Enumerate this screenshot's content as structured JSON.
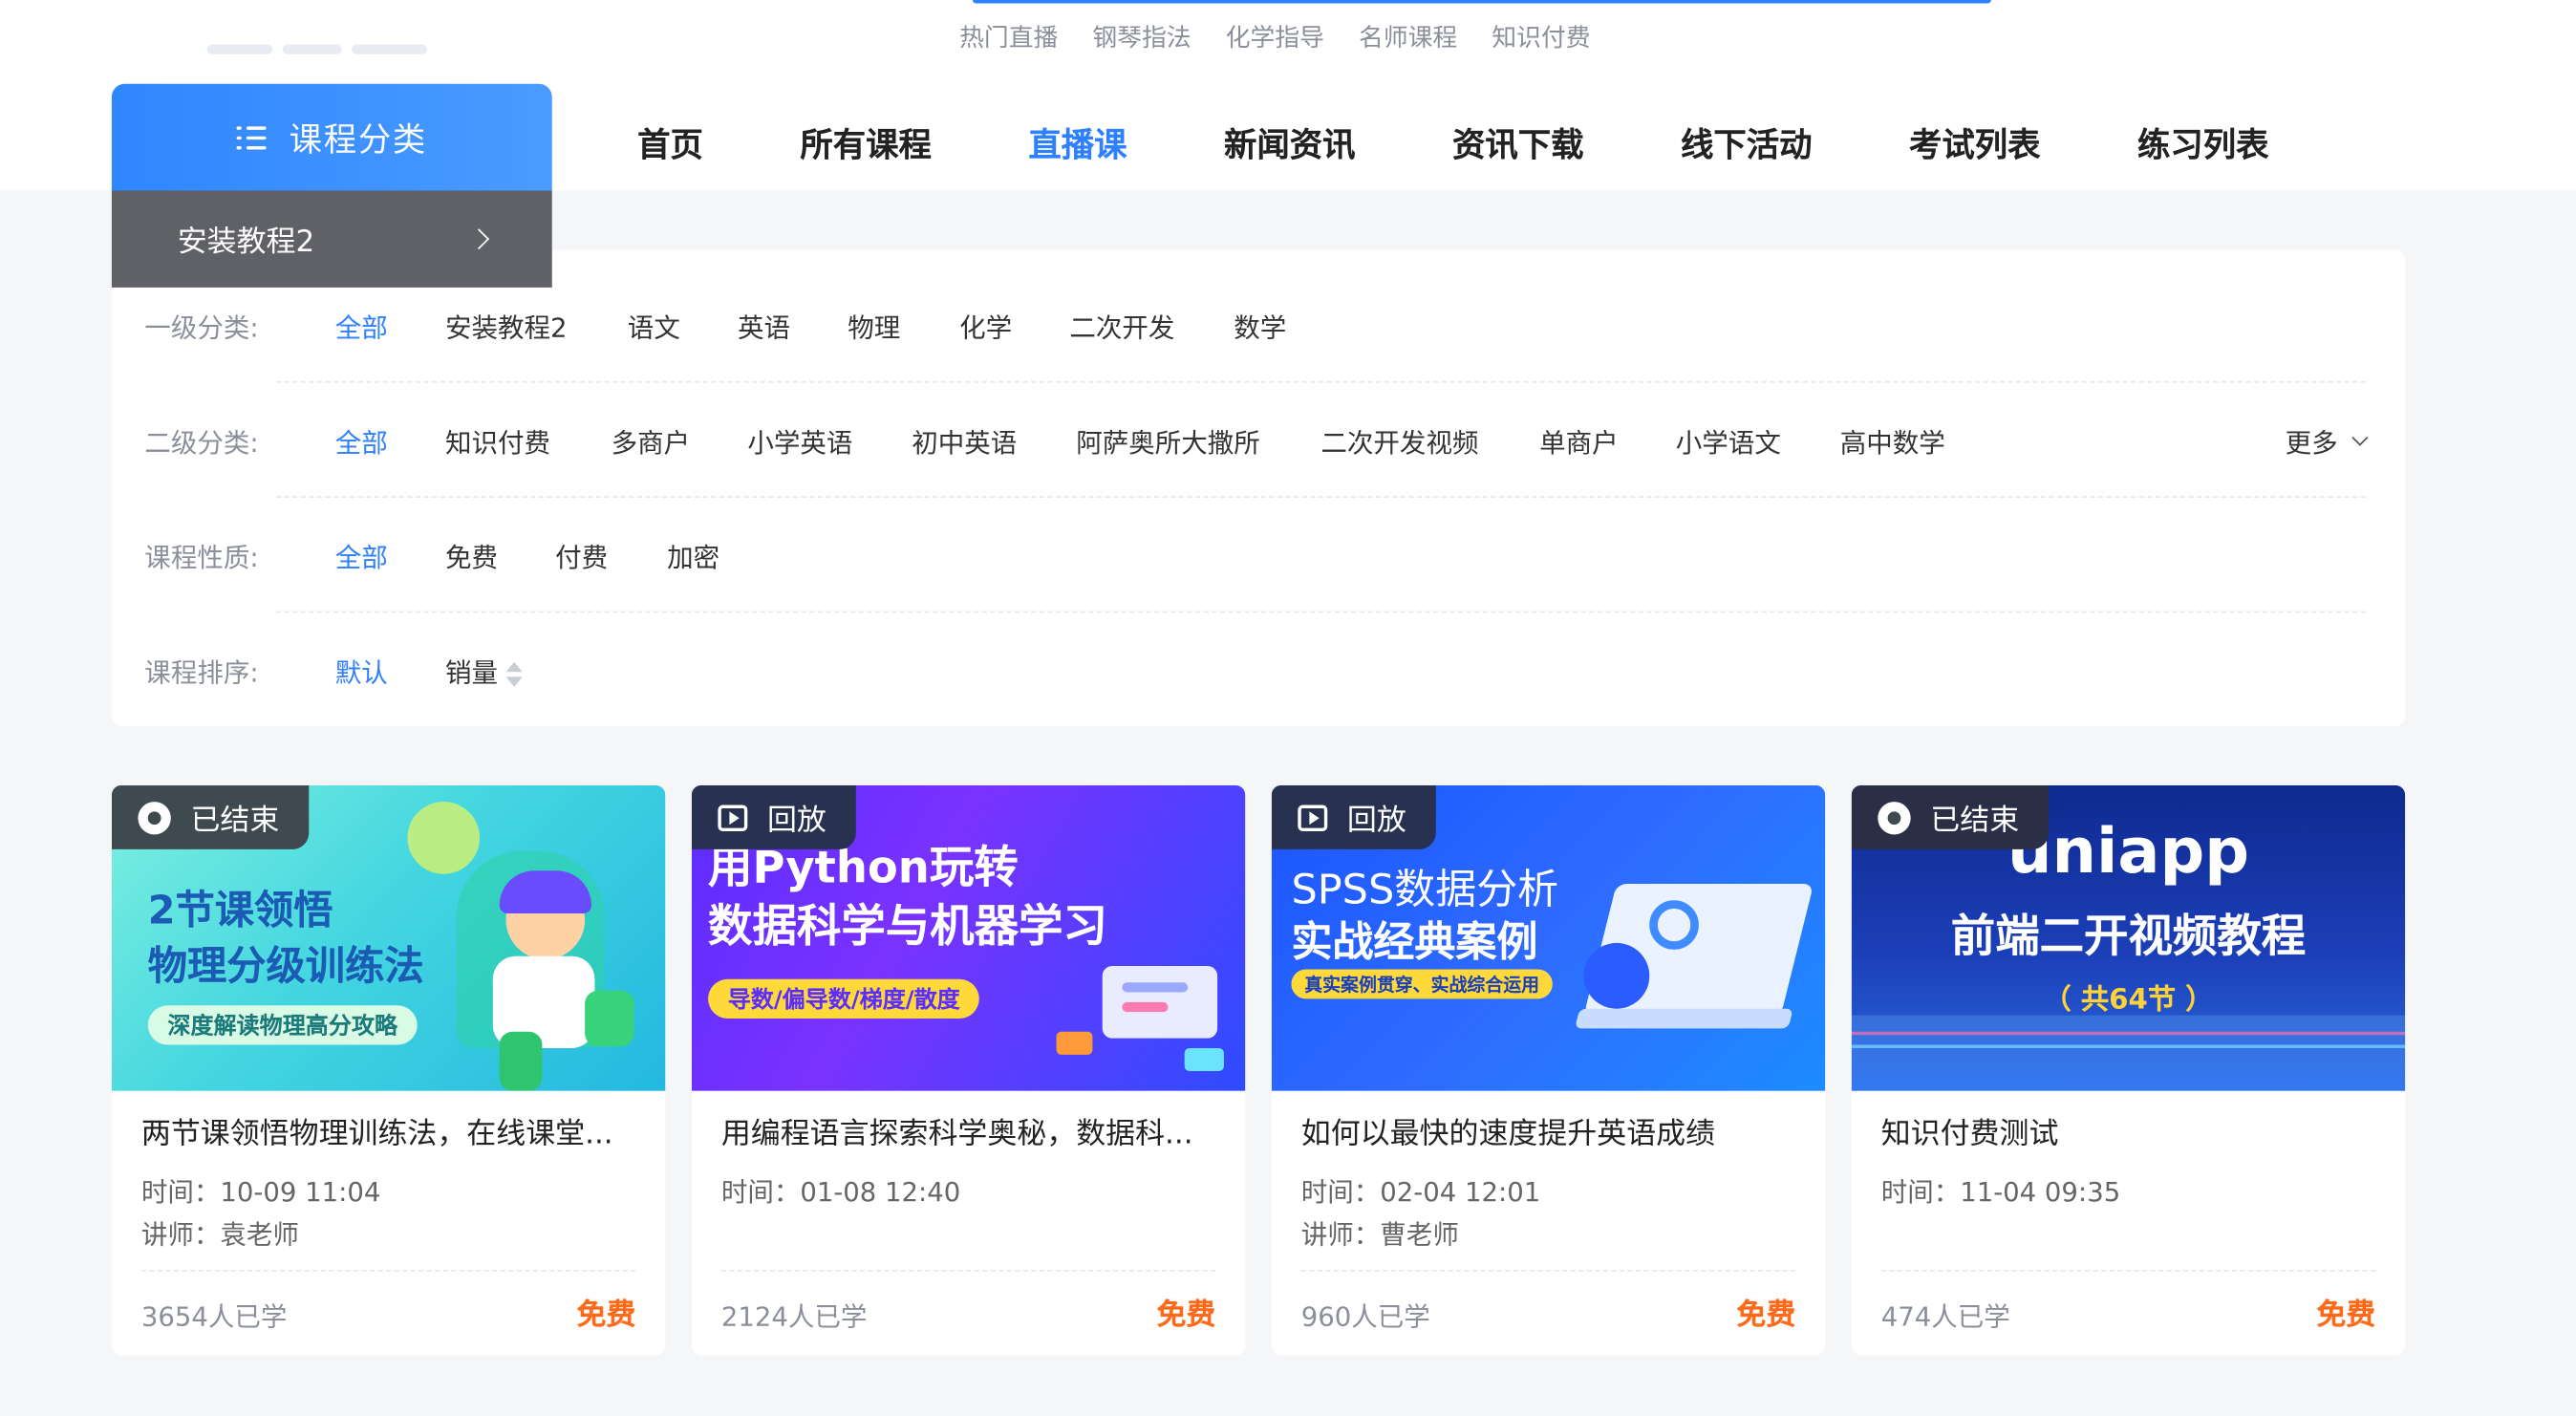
{
  "header": {
    "hot_keywords": [
      "热门直播",
      "钢琴指法",
      "化学指导",
      "名师课程",
      "知识付费"
    ]
  },
  "category_panel": {
    "button_label": "课程分类",
    "item_label": "安装教程2"
  },
  "main_nav": [
    {
      "label": "首页",
      "active": false
    },
    {
      "label": "所有课程",
      "active": false
    },
    {
      "label": "直播课",
      "active": true
    },
    {
      "label": "新闻资讯",
      "active": false
    },
    {
      "label": "资讯下载",
      "active": false
    },
    {
      "label": "线下活动",
      "active": false
    },
    {
      "label": "考试列表",
      "active": false
    },
    {
      "label": "练习列表",
      "active": false
    }
  ],
  "filters": {
    "level1": {
      "label": "一级分类:",
      "options": [
        "全部",
        "安装教程2",
        "语文",
        "英语",
        "物理",
        "化学",
        "二次开发",
        "数学"
      ]
    },
    "level2": {
      "label": "二级分类:",
      "options": [
        "全部",
        "知识付费",
        "多商户",
        "小学英语",
        "初中英语",
        "阿萨奥所大撒所",
        "二次开发视频",
        "单商户",
        "小学语文",
        "高中数学"
      ],
      "more": "更多"
    },
    "nature": {
      "label": "课程性质:",
      "options": [
        "全部",
        "免费",
        "付费",
        "加密"
      ]
    },
    "sort": {
      "label": "课程排序:",
      "options": [
        "默认",
        "销量"
      ]
    }
  },
  "courses": [
    {
      "status": "已结束",
      "title": "两节课领悟物理训练法，在线课堂...",
      "time": "时间：10-09 11:04",
      "teacher": "讲师：袁老师",
      "learners": "3654人已学",
      "price": "免费",
      "thumb_lines": [
        "2节课领悟",
        "物理分级训练法"
      ],
      "thumb_tag": "深度解读物理高分攻略"
    },
    {
      "status": "回放",
      "title": "用编程语言探索科学奥秘，数据科...",
      "time": "时间：01-08 12:40",
      "teacher": "",
      "learners": "2124人已学",
      "price": "免费",
      "thumb_lines": [
        "用Python玩转",
        "数据科学与机器学习"
      ],
      "thumb_tag": "导数/偏导数/梯度/散度"
    },
    {
      "status": "回放",
      "title": "如何以最快的速度提升英语成绩",
      "time": "时间：02-04 12:01",
      "teacher": "讲师：曹老师",
      "learners": "960人已学",
      "price": "免费",
      "thumb_lines": [
        "SPSS数据分析",
        "实战经典案例"
      ],
      "thumb_tag": "真实案例贯穿、实战综合运用"
    },
    {
      "status": "已结束",
      "title": "知识付费测试",
      "time": "时间：11-04 09:35",
      "teacher": "",
      "learners": "474人已学",
      "price": "免费",
      "thumb_lines": [
        "uniapp",
        "前端二开视频教程"
      ],
      "thumb_tag": "（ 共64节 ）"
    }
  ],
  "colors": {
    "accent": "#2f80ff",
    "price": "#ff6a1a",
    "category_item_bg": "#5f6166"
  }
}
